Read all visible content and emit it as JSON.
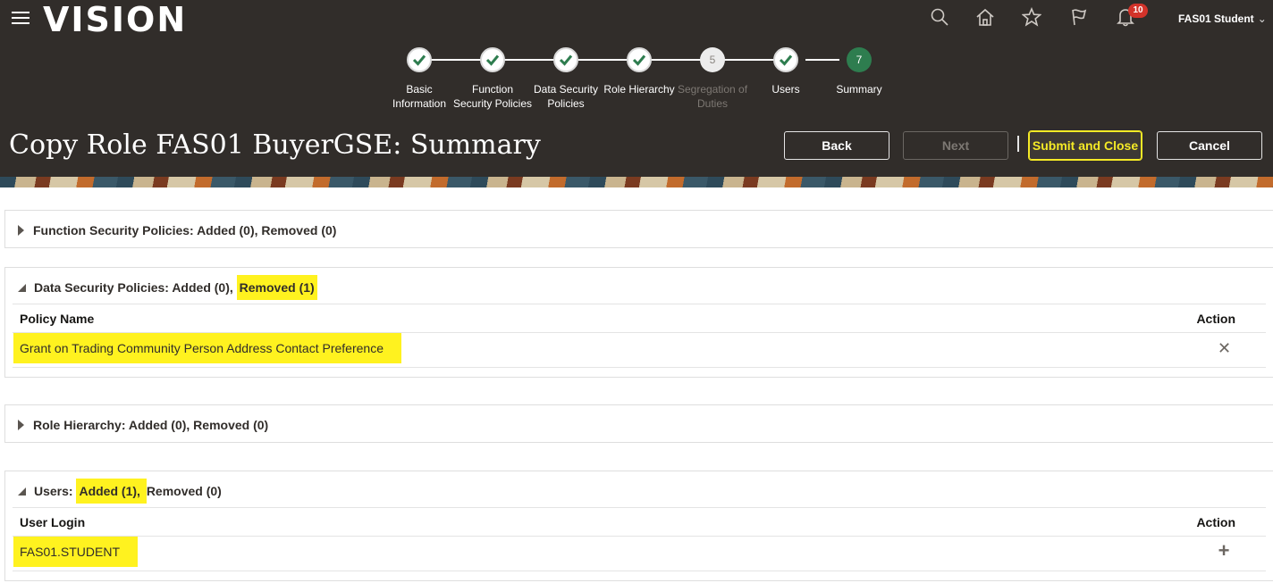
{
  "app": {
    "logo": "VISION"
  },
  "header": {
    "notification_count": "10",
    "user_name": "FAS01 Student"
  },
  "train": {
    "stops": [
      {
        "num": "",
        "label_line1": "Basic",
        "label_line2": "Information",
        "state": "done"
      },
      {
        "num": "",
        "label_line1": "Function",
        "label_line2": "Security Policies",
        "state": "done"
      },
      {
        "num": "",
        "label_line1": "Data Security",
        "label_line2": "Policies",
        "state": "done"
      },
      {
        "num": "",
        "label_line1": "Role Hierarchy",
        "label_line2": "",
        "state": "done"
      },
      {
        "num": "5",
        "label_line1": "Segregation of",
        "label_line2": "Duties",
        "state": "disabled"
      },
      {
        "num": "",
        "label_line1": "Users",
        "label_line2": "",
        "state": "done"
      },
      {
        "num": "7",
        "label_line1": "Summary",
        "label_line2": "",
        "state": "current"
      }
    ]
  },
  "page": {
    "title": "Copy Role FAS01 BuyerGSE: Summary"
  },
  "buttons": {
    "back": "Back",
    "next": "Next",
    "submit_close": "Submit and Close",
    "cancel": "Cancel"
  },
  "sections": {
    "function_security": {
      "title": "Function Security Policies: Added (0), Removed (0)"
    },
    "data_security": {
      "title_prefix": "Data Security Policies: Added (0), ",
      "title_highlight": "Removed (1)",
      "col_name": "Policy Name",
      "col_action": "Action",
      "rows": [
        {
          "name": "Grant on Trading Community Person Address Contact Preference"
        }
      ]
    },
    "role_hierarchy": {
      "title": "Role Hierarchy: Added (0), Removed (0)"
    },
    "users": {
      "title_prefix": "Users: ",
      "title_highlight": "Added (1), ",
      "title_suffix": "Removed (0)",
      "col_name": "User Login",
      "col_action": "Action",
      "rows": [
        {
          "name": "FAS01.STUDENT"
        }
      ]
    }
  },
  "icons": {
    "search": "search-icon",
    "home": "home-icon",
    "favorites": "star-icon",
    "flag": "flag-icon",
    "notifications": "bell-icon",
    "remove": "close-icon",
    "add": "plus-icon"
  }
}
